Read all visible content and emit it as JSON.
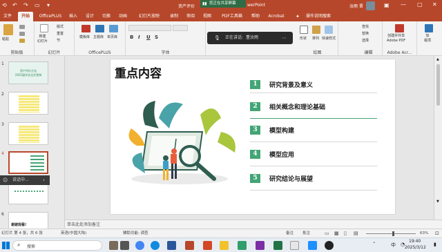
{
  "titlebar": {
    "file_name_left": "资产评价",
    "app_suffix": "werPoint",
    "user_name": "汝雨 晋",
    "notification": "您正在共享屏幕"
  },
  "tabs": [
    {
      "label": "文件"
    },
    {
      "label": "开始"
    },
    {
      "label": "OfficePLUS"
    },
    {
      "label": "插入"
    },
    {
      "label": "设计"
    },
    {
      "label": "切换"
    },
    {
      "label": "动画"
    },
    {
      "label": "幻灯片放映"
    },
    {
      "label": "录制"
    },
    {
      "label": "审阅"
    },
    {
      "label": "视图"
    },
    {
      "label": "PDF工具箱"
    },
    {
      "label": "帮助"
    },
    {
      "label": "Acrobat"
    },
    {
      "label": "操作说明搜索"
    }
  ],
  "ribbon": {
    "clipboard": {
      "paste": "粘贴",
      "group": "剪贴板"
    },
    "slides": {
      "new_slide": "新建\n幻灯片",
      "layout": "版式",
      "reset": "重置",
      "section": "节",
      "group": "幻灯片"
    },
    "officeplus": {
      "b1": "模板库",
      "b2": "主题库",
      "b3": "单页库",
      "group": "OfficePLUS"
    },
    "font": {
      "group": "字体",
      "bold": "B",
      "italic": "I",
      "underline": "U",
      "strike": "S"
    },
    "voice": {
      "status": "正在讲话:",
      "speaker": "董汝雨"
    },
    "drawing": {
      "shape": "形状",
      "arrange": "排列",
      "quick": "快速样式",
      "group": "绘图"
    },
    "editing": {
      "find": "查找",
      "replace": "替换",
      "select": "选择",
      "group": "编辑"
    },
    "acrobat": {
      "create": "创建并共享\nAdobe PDF",
      "group": "Adobe Acr..."
    },
    "addin": {
      "load": "加\n载项",
      "group": "加载项"
    }
  },
  "slides": [
    {
      "num": "1",
      "caption": "资产评价方法\n2025届毕业论文答辩"
    },
    {
      "num": "2"
    },
    {
      "num": "3"
    },
    {
      "num": "4",
      "active": true
    },
    {
      "num": "5"
    },
    {
      "num": "6",
      "caption": "谢谢观看!"
    }
  ],
  "tooltip": {
    "text": "说话中..."
  },
  "slide": {
    "title": "重点内容",
    "items": [
      {
        "num": "1",
        "text": "研究背景及意义"
      },
      {
        "num": "2",
        "text": "相关概念和理论基础"
      },
      {
        "num": "3",
        "text": "模型构建"
      },
      {
        "num": "4",
        "text": "模型应用"
      },
      {
        "num": "5",
        "text": "研究结论与展望"
      }
    ]
  },
  "notes": {
    "placeholder": "单击此处添加备注"
  },
  "statusbar": {
    "slide_info": "幻灯片 第 4 张，共 6 张",
    "language": "英语(中国大陆)",
    "accessibility": "辅助功能: 调查",
    "notes": "备注",
    "comments": "批注",
    "zoom": "63%"
  },
  "taskbar": {
    "search": "搜索",
    "time": "19:40",
    "date": "2025/3/12",
    "ime": "中"
  },
  "colors": {
    "accent": "#b7472a",
    "item_green": "#43a575"
  }
}
